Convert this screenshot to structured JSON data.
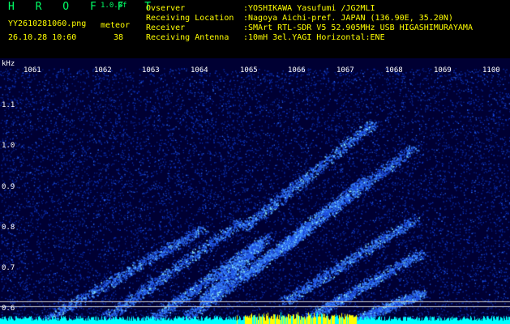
{
  "header": {
    "app_title": "H R O F F T",
    "version": "1.0.0f",
    "file_name": "YY2610281060.png",
    "category": "meteor",
    "datetime": "26.10.28 10:60",
    "count": "38",
    "info": [
      {
        "label": "Ovserver",
        "value": ":YOSHIKAWA Yasufumi /JG2MLI"
      },
      {
        "label": "Receiving Location",
        "value": ":Nagoya Aichi-pref. JAPAN (136.90E, 35.20N)"
      },
      {
        "label": "Receiver",
        "value": ":SMArt RTL-SDR V5 52.905MHz USB HIGASHIMURAYAMA"
      },
      {
        "label": "Receiving Antenna",
        "value": ":10mH 3el.YAGI Horizontal:ENE"
      }
    ]
  },
  "spectrogram": {
    "unit_label": "kHz",
    "y_ticks": [
      "1.1",
      "1.0",
      "0.9",
      "0.8",
      "0.7",
      "0.6"
    ],
    "x_ticks": [
      "1061",
      "1062",
      "1063",
      "1064",
      "1065",
      "1066",
      "1067",
      "1068",
      "1069",
      "1100"
    ],
    "colors": {
      "background": "#000033",
      "noise": "#0a2aa0",
      "signal": "#8ef0ff",
      "peak": "#ffff00",
      "baseline": "#00ffff"
    }
  }
}
